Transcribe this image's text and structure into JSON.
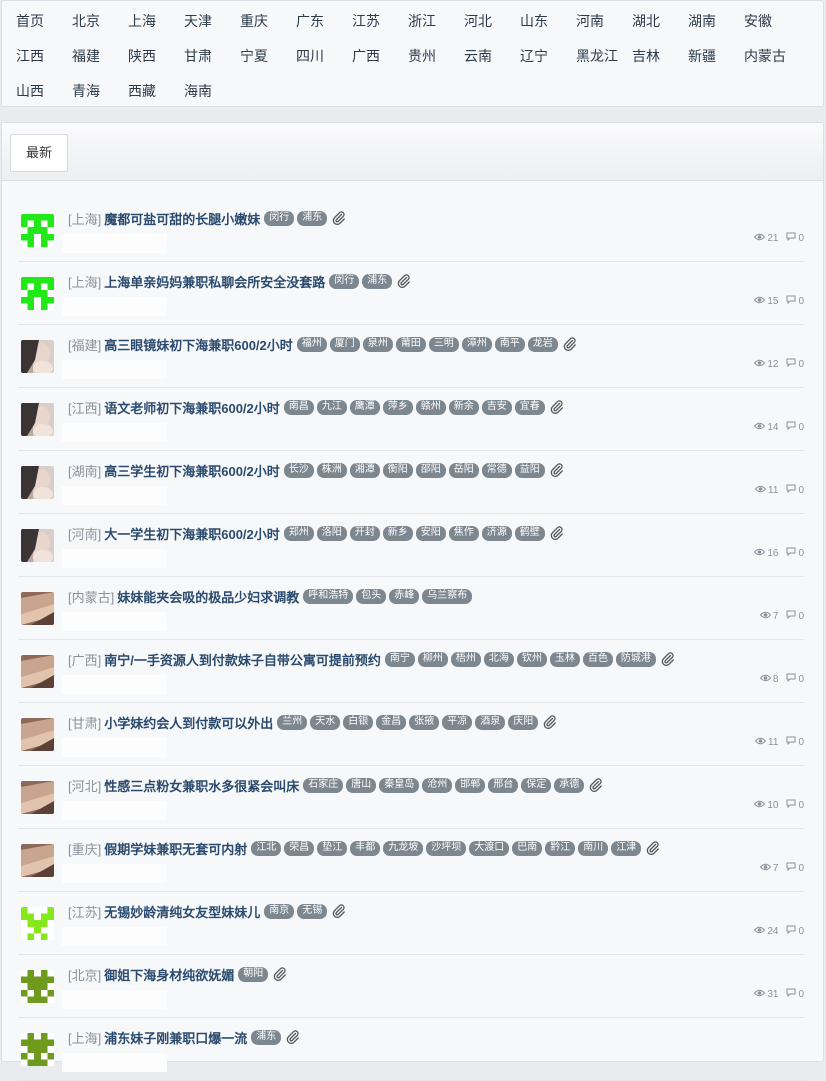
{
  "nav": {
    "items": [
      "首页",
      "北京",
      "上海",
      "天津",
      "重庆",
      "广东",
      "江苏",
      "浙江",
      "河北",
      "山东",
      "河南",
      "湖北",
      "湖南",
      "安徽",
      "江西",
      "福建",
      "陕西",
      "甘肃",
      "宁夏",
      "四川",
      "广西",
      "贵州",
      "云南",
      "辽宁",
      "黑龙江",
      "吉林",
      "新疆",
      "内蒙古",
      "山西",
      "青海",
      "西藏",
      "海南"
    ]
  },
  "tabs": {
    "latest": "最新"
  },
  "posts": [
    {
      "region": "[上海]",
      "title": "魔都可盐可甜的长腿小嫩妹",
      "tags": [
        "闵行",
        "浦东"
      ],
      "attach": true,
      "views": "21",
      "replies": "0",
      "avatar": "pixel-green"
    },
    {
      "region": "[上海]",
      "title": "上海单亲妈妈兼职私聊会所安全没套路",
      "tags": [
        "闵行",
        "浦东"
      ],
      "attach": true,
      "views": "15",
      "replies": "0",
      "avatar": "pixel-green"
    },
    {
      "region": "[福建]",
      "title": "高三眼镜妹初下海兼职600/2小时",
      "tags": [
        "福州",
        "厦门",
        "泉州",
        "莆田",
        "三明",
        "漳州",
        "南平",
        "龙岩"
      ],
      "attach": true,
      "views": "12",
      "replies": "0",
      "avatar": "photo-a"
    },
    {
      "region": "[江西]",
      "title": "语文老师初下海兼职600/2小时",
      "tags": [
        "南昌",
        "九江",
        "鹰潭",
        "萍乡",
        "赣州",
        "新余",
        "吉安",
        "宜春"
      ],
      "attach": true,
      "views": "14",
      "replies": "0",
      "avatar": "photo-a"
    },
    {
      "region": "[湖南]",
      "title": "高三学生初下海兼职600/2小时",
      "tags": [
        "长沙",
        "株洲",
        "湘潭",
        "衡阳",
        "邵阳",
        "岳阳",
        "常德",
        "益阳"
      ],
      "attach": true,
      "views": "11",
      "replies": "0",
      "avatar": "photo-a"
    },
    {
      "region": "[河南]",
      "title": "大一学生初下海兼职600/2小时",
      "tags": [
        "郑州",
        "洛阳",
        "开封",
        "新乡",
        "安阳",
        "焦作",
        "济源",
        "鹤壁"
      ],
      "attach": true,
      "views": "16",
      "replies": "0",
      "avatar": "photo-a"
    },
    {
      "region": "[内蒙古]",
      "title": "妹妹能夹会吸的极品少妇求调教",
      "tags": [
        "呼和浩特",
        "包头",
        "赤峰",
        "乌兰察布"
      ],
      "attach": false,
      "views": "7",
      "replies": "0",
      "avatar": "photo-b"
    },
    {
      "region": "[广西]",
      "title": "南宁/一手资源人到付款妹子自带公寓可提前预约",
      "tags": [
        "南宁",
        "柳州",
        "梧州",
        "北海",
        "钦州",
        "玉林",
        "百色",
        "防城港"
      ],
      "attach": true,
      "views": "8",
      "replies": "0",
      "avatar": "photo-b"
    },
    {
      "region": "[甘肃]",
      "title": "小学妹约会人到付款可以外出",
      "tags": [
        "兰州",
        "天水",
        "白银",
        "金昌",
        "张掖",
        "平凉",
        "酒泉",
        "庆阳"
      ],
      "attach": true,
      "views": "11",
      "replies": "0",
      "avatar": "photo-b"
    },
    {
      "region": "[河北]",
      "title": "性感三点粉女兼职水多很紧会叫床",
      "tags": [
        "石家庄",
        "唐山",
        "秦皇岛",
        "沧州",
        "邯郸",
        "邢台",
        "保定",
        "承德"
      ],
      "attach": true,
      "views": "10",
      "replies": "0",
      "avatar": "photo-b"
    },
    {
      "region": "[重庆]",
      "title": "假期学妹兼职无套可内射",
      "tags": [
        "江北",
        "荣昌",
        "垫江",
        "丰都",
        "九龙坡",
        "沙坪坝",
        "大渡口",
        "巴南",
        "黔江",
        "南川",
        "江津"
      ],
      "attach": true,
      "views": "7",
      "replies": "0",
      "avatar": "photo-b"
    },
    {
      "region": "[江苏]",
      "title": "无锡妙龄清纯女友型妹妹儿",
      "tags": [
        "南京",
        "无锡"
      ],
      "attach": true,
      "views": "24",
      "replies": "0",
      "avatar": "pixel-lime"
    },
    {
      "region": "[北京]",
      "title": "御姐下海身材纯欲妩媚",
      "tags": [
        "朝阳"
      ],
      "attach": true,
      "views": "31",
      "replies": "0",
      "avatar": "pixel-olive"
    },
    {
      "region": "[上海]",
      "title": "浦东妹子刚兼职口爆一流",
      "tags": [
        "浦东"
      ],
      "attach": true,
      "views": "",
      "replies": "",
      "avatar": "pixel-olive"
    }
  ],
  "colors": {
    "pixel-green": "#22e81a",
    "pixel-lime": "#86e81a",
    "pixel-olive": "#6f9a1e",
    "tag": "#7d8790",
    "title": "#2a4a6e"
  }
}
